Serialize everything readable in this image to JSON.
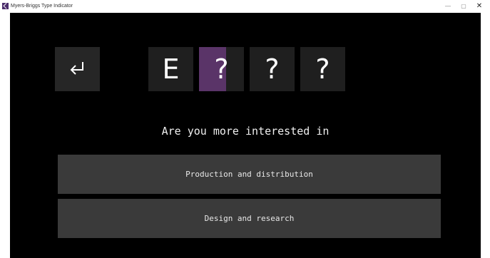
{
  "window": {
    "title": "Myers-Briggs Type Indicator",
    "minimize_glyph": "—",
    "maximize_glyph": "▢",
    "close_glyph": "✕"
  },
  "back_button": {
    "icon": "return-arrow-icon"
  },
  "type_letters": [
    {
      "label": "E",
      "progress": 0
    },
    {
      "label": "?",
      "progress": 0.6
    },
    {
      "label": "?",
      "progress": 0
    },
    {
      "label": "?",
      "progress": 0
    }
  ],
  "question": "Are you more interested in",
  "answers": [
    {
      "label": "Production and distribution"
    },
    {
      "label": "Design and research"
    }
  ],
  "colors": {
    "background": "#000000",
    "tile": "#1f1f1f",
    "accent": "#5a3468",
    "answer": "#3a3a3a"
  }
}
